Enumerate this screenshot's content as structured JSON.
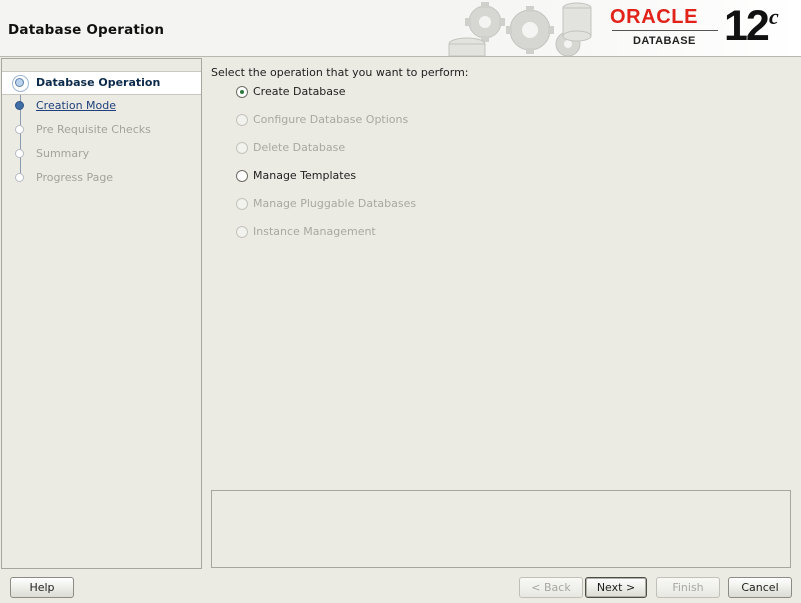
{
  "header": {
    "title": "Database Operation",
    "brand": {
      "name": "ORACLE",
      "product": "DATABASE",
      "version": "12",
      "version_suffix": "c",
      "brand_color": "#e2231a"
    }
  },
  "steps": [
    {
      "label": "Database Operation",
      "state": "current"
    },
    {
      "label": "Creation Mode",
      "state": "link"
    },
    {
      "label": "Pre Requisite Checks",
      "state": "disabled"
    },
    {
      "label": "Summary",
      "state": "disabled"
    },
    {
      "label": "Progress Page",
      "state": "disabled"
    }
  ],
  "main": {
    "prompt": "Select the operation that you want to perform:",
    "options": [
      {
        "label": "Create Database",
        "checked": true,
        "enabled": true
      },
      {
        "label": "Configure Database Options",
        "checked": false,
        "enabled": false
      },
      {
        "label": "Delete Database",
        "checked": false,
        "enabled": false
      },
      {
        "label": "Manage Templates",
        "checked": false,
        "enabled": true
      },
      {
        "label": "Manage Pluggable Databases",
        "checked": false,
        "enabled": false
      },
      {
        "label": "Instance Management",
        "checked": false,
        "enabled": false
      }
    ],
    "description": ""
  },
  "buttons": {
    "help": "Help",
    "back": "< Back",
    "next": "Next >",
    "finish": "Finish",
    "cancel": "Cancel"
  }
}
